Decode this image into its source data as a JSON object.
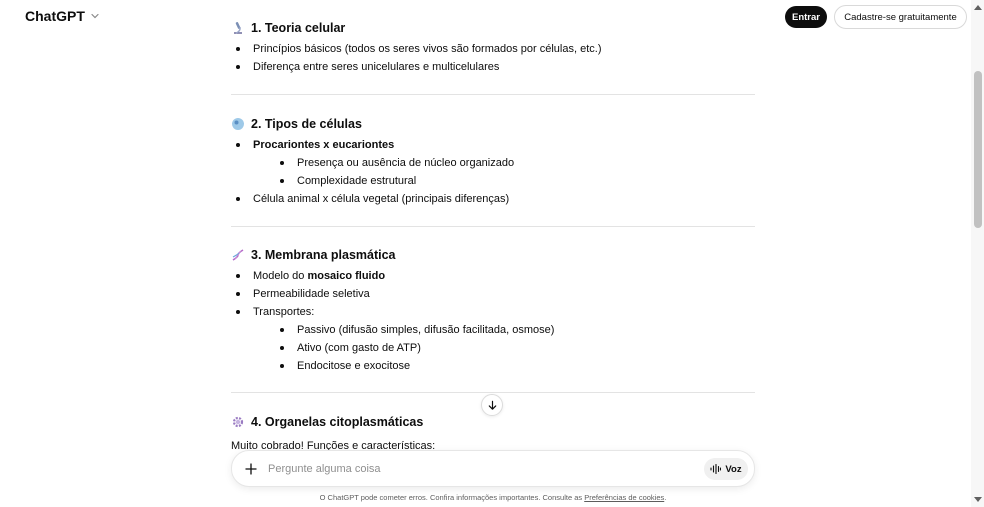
{
  "header": {
    "brand": "ChatGPT",
    "login_label": "Entrar",
    "signup_label": "Cadastre-se gratuitamente"
  },
  "sections": [
    {
      "emoji": "microscope-icon",
      "title": "1. Teoria celular",
      "items": [
        "Princípios básicos (todos os seres vivos são formados por células, etc.)",
        "Diferença entre seres unicelulares e multicelulares"
      ]
    },
    {
      "emoji": "cell-icon",
      "title": "2. Tipos de células",
      "items": [
        {
          "text": "Procariontes x eucariontes",
          "bold": true,
          "sub": [
            "Presença ou ausência de núcleo organizado",
            "Complexidade estrutural"
          ]
        },
        "Célula animal x célula vegetal (principais diferenças)"
      ]
    },
    {
      "emoji": "dna-icon",
      "title": "3. Membrana plasmática",
      "items": [
        {
          "prefix": "Modelo do ",
          "bold_text": "mosaico fluido"
        },
        "Permeabilidade seletiva",
        {
          "text": "Transportes:",
          "sub": [
            "Passivo (difusão simples, difusão facilitada, osmose)",
            "Ativo (com gasto de ATP)",
            "Endocitose e exocitose"
          ]
        }
      ]
    },
    {
      "emoji": "gear-icon",
      "title": "4. Organelas citoplasmáticas",
      "partial_text": "Muito cobrado! Funções e características:"
    }
  ],
  "composer": {
    "placeholder": "Pergunte alguma coisa",
    "voice_label": "Voz"
  },
  "footer": {
    "text": "O ChatGPT pode cometer erros. Confira informações importantes. Consulte as ",
    "link": "Preferências de cookies",
    "suffix": "."
  }
}
